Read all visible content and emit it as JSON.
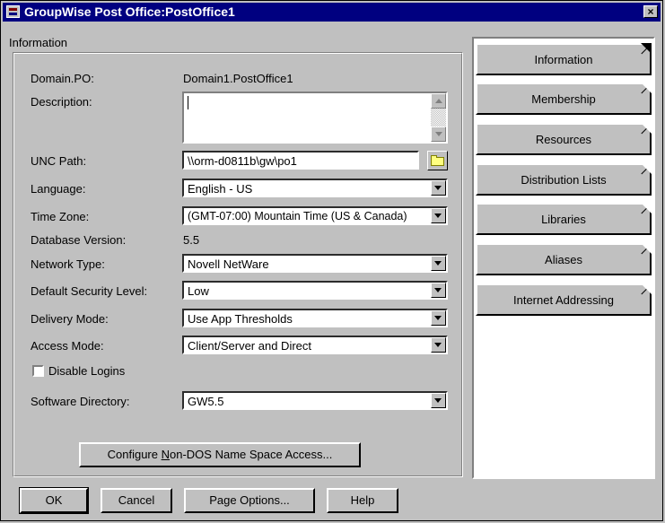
{
  "window": {
    "title": "GroupWise Post Office:PostOffice1",
    "close_label": "×"
  },
  "panel": {
    "title": "Information"
  },
  "fields": {
    "domain_po": {
      "label": "Domain.PO:",
      "value": "Domain1.PostOffice1"
    },
    "description": {
      "label": "Description:",
      "value": ""
    },
    "unc_path": {
      "label": "UNC Path:",
      "value": "\\\\orm-d0811b\\gw\\po1"
    },
    "language": {
      "label": "Language:",
      "value": "English - US"
    },
    "time_zone": {
      "label": "Time Zone:",
      "value": "(GMT-07:00) Mountain Time (US & Canada)"
    },
    "database_version": {
      "label": "Database Version:",
      "value": "5.5"
    },
    "network_type": {
      "label": "Network Type:",
      "value": "Novell NetWare"
    },
    "default_security_level": {
      "label": "Default Security Level:",
      "value": "Low"
    },
    "delivery_mode": {
      "label": "Delivery Mode:",
      "value": "Use App Thresholds"
    },
    "access_mode": {
      "label": "Access Mode:",
      "value": "Client/Server and Direct"
    },
    "disable_logins": {
      "label": "Disable Logins",
      "checked": false
    },
    "software_directory": {
      "label": "Software Directory:",
      "value": "GW5.5"
    }
  },
  "configure_button": {
    "prefix": "Configure ",
    "mnemonic": "N",
    "suffix": "on-DOS Name Space Access..."
  },
  "buttons": {
    "ok": "OK",
    "cancel": "Cancel",
    "page_options": "Page Options...",
    "help": "Help"
  },
  "tabs": [
    {
      "label": "Information",
      "active": true
    },
    {
      "label": "Membership",
      "active": false
    },
    {
      "label": "Resources",
      "active": false
    },
    {
      "label": "Distribution Lists",
      "active": false
    },
    {
      "label": "Libraries",
      "active": false
    },
    {
      "label": "Aliases",
      "active": false
    },
    {
      "label": "Internet Addressing",
      "active": false
    }
  ],
  "colors": {
    "titlebar": "#000080",
    "face": "#c0c0c0"
  }
}
